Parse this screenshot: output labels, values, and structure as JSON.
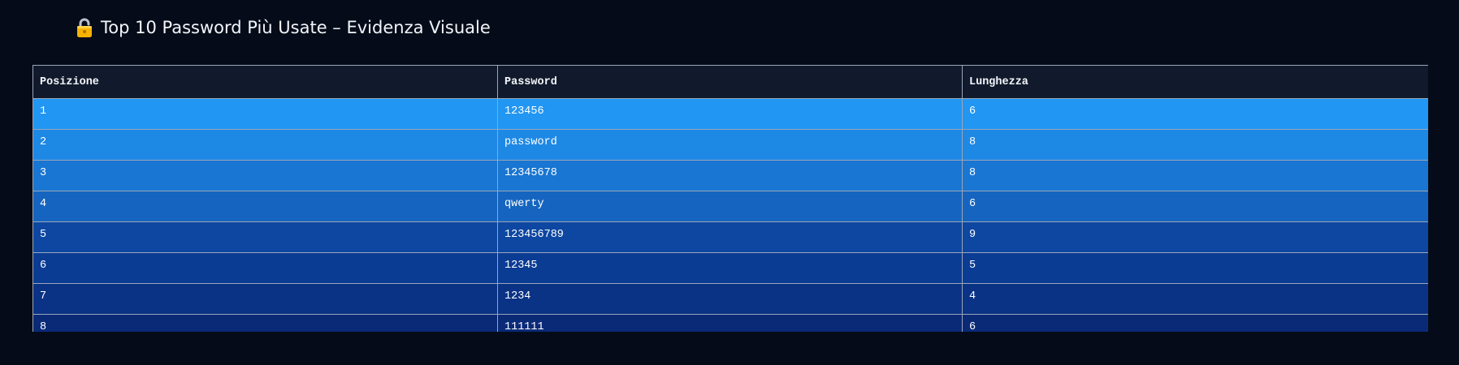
{
  "page": {
    "title": "Top 10 Password Più Usate – Evidenza Visuale",
    "title_icon": "lock-icon"
  },
  "table": {
    "headers": [
      "Posizione",
      "Password",
      "Lunghezza"
    ],
    "rows": [
      {
        "position": "1",
        "password": "123456",
        "length": "6",
        "color": "#2196f3"
      },
      {
        "position": "2",
        "password": "password",
        "length": "8",
        "color": "#1e88e5"
      },
      {
        "position": "3",
        "password": "12345678",
        "length": "8",
        "color": "#1976d2"
      },
      {
        "position": "4",
        "password": "qwerty",
        "length": "6",
        "color": "#1565c0"
      },
      {
        "position": "5",
        "password": "123456789",
        "length": "9",
        "color": "#0d47a1"
      },
      {
        "position": "6",
        "password": "12345",
        "length": "5",
        "color": "#0b3c94"
      },
      {
        "position": "7",
        "password": "1234",
        "length": "4",
        "color": "#0a3285"
      },
      {
        "position": "8",
        "password": "111111",
        "length": "6",
        "color": "#0a2a78"
      }
    ]
  },
  "colors": {
    "background": "#050b18",
    "header_background": "#101a2c",
    "border": "#9aa6b8"
  }
}
